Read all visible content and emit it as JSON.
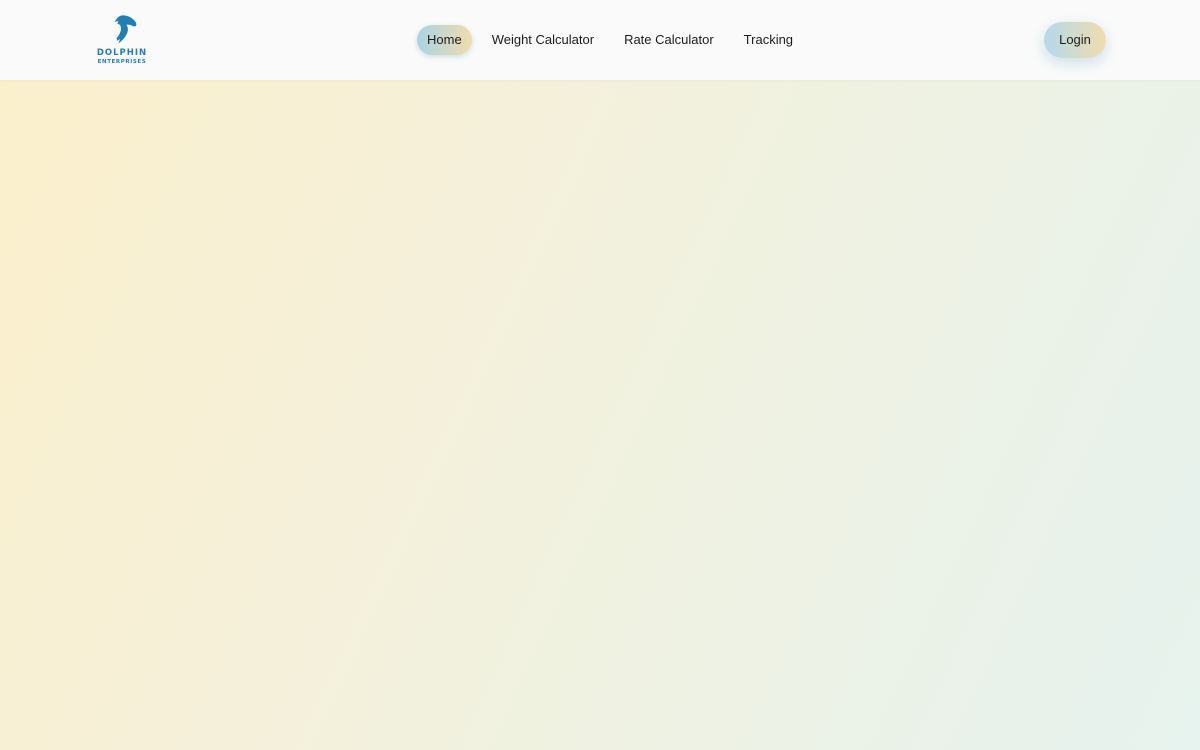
{
  "brand": {
    "name_line1": "DOLPHIN",
    "name_line2": "ENTERPRISES",
    "logo_icon": "dolphin-icon",
    "color": "#1f7fb8"
  },
  "nav": {
    "links": [
      {
        "label": "Home",
        "active": true
      },
      {
        "label": "Weight Calculator",
        "active": false
      },
      {
        "label": "Rate Calculator",
        "active": false
      },
      {
        "label": "Tracking",
        "active": false
      }
    ]
  },
  "header": {
    "login_label": "Login"
  },
  "colors": {
    "accent_gradient_start": "#a9d4e4",
    "accent_gradient_end": "#f0dcac",
    "hero_gradient_start": "#fbf0cc",
    "hero_gradient_end": "#e7f3ee"
  }
}
